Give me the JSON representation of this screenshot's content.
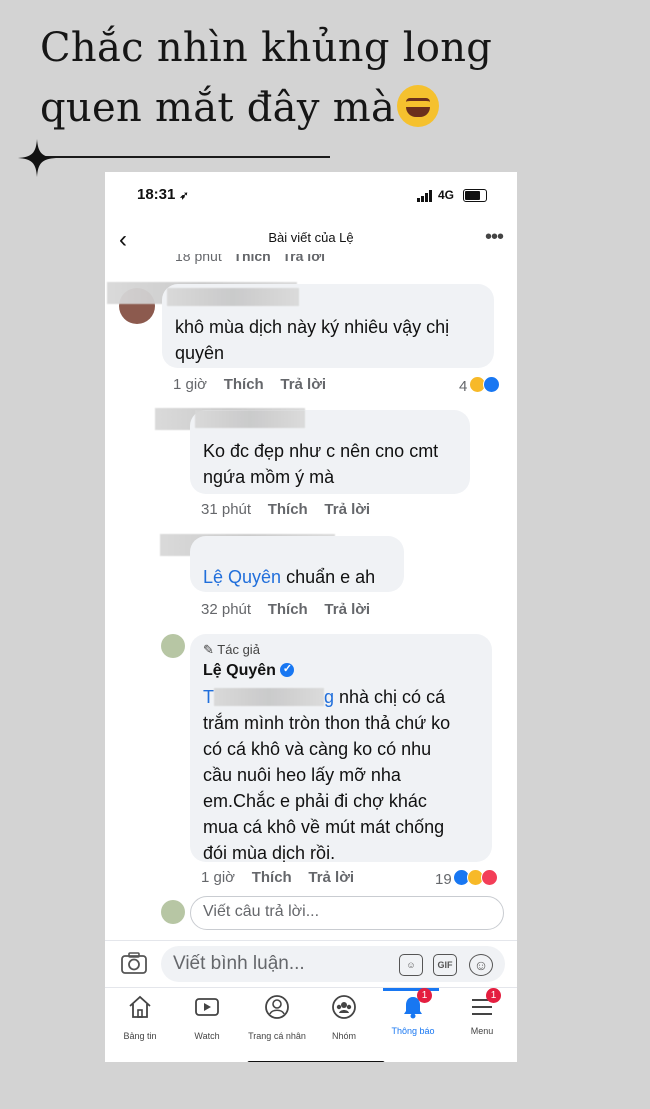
{
  "caption": {
    "line1": "Chắc nhìn khủng long",
    "line2": "quen mắt đây mà"
  },
  "status_bar": {
    "time": "18:31",
    "network": "4G"
  },
  "nav": {
    "title": "Bài viết của Lệ"
  },
  "top_partial_meta": {
    "time": "18 phút",
    "like": "Thích",
    "reply": "Trả lời"
  },
  "comments": [
    {
      "text_line1": "khô mùa dịch này ký nhiêu vậy chị",
      "text_line2": "quyên",
      "time": "1 giờ",
      "like": "Thích",
      "reply": "Trả lời",
      "reaction_count": "4"
    },
    {
      "text_line1": "Ko đc đẹp như c nên cno cmt",
      "text_line2": "ngứa mồm ý mà",
      "time": "31 phút",
      "like": "Thích",
      "reply": "Trả lời"
    },
    {
      "mention": "Lệ Quyên",
      "text_line1_rest": " chuẩn e ah",
      "time": "32 phút",
      "like": "Thích",
      "reply": "Trả lời"
    },
    {
      "badge": "Tác giả",
      "author": "Lệ Quyên",
      "mention_partial": "T",
      "mention_tail": "g",
      "lines": [
        " nhà chị có cá",
        "trắm mình tròn thon thả chứ ko",
        "có cá khô và càng ko có nhu",
        "cầu nuôi heo lấy mỡ nha",
        "em.Chắc e phải đi chợ khác",
        "mua cá khô về mút mát chống",
        "đói mùa dịch rồi."
      ],
      "time": "1 giờ",
      "like": "Thích",
      "reply": "Trả lời",
      "reaction_count": "19"
    }
  ],
  "reply_box": {
    "placeholder": "Viết câu trả lời..."
  },
  "composer": {
    "placeholder": "Viết bình luận...",
    "gif": "GIF"
  },
  "tabs": [
    {
      "label": "Bảng tin",
      "icon": "home-icon"
    },
    {
      "label": "Watch",
      "icon": "watch-icon"
    },
    {
      "label": "Trang cá nhân",
      "icon": "profile-icon"
    },
    {
      "label": "Nhóm",
      "icon": "groups-icon"
    },
    {
      "label": "Thông báo",
      "icon": "bell-icon",
      "badge": "1",
      "active": true
    },
    {
      "label": "Menu",
      "icon": "menu-icon",
      "badge": "1"
    }
  ],
  "colors": {
    "accent": "#1877f2",
    "bubble": "#f0f2f5",
    "background": "#d3d3d3",
    "link": "#216fdb"
  }
}
